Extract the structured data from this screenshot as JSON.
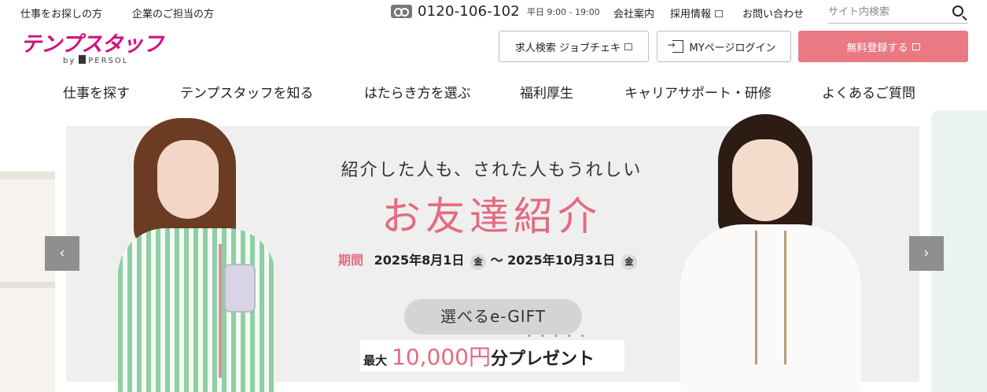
{
  "topbar": {
    "links": [
      "仕事をお探しの方",
      "企業のご担当の方"
    ],
    "phone": "0120-106-102",
    "hours": "平日 9:00 - 19:00",
    "right_links": [
      "会社案内",
      "採用情報",
      "お問い合わせ"
    ],
    "search_placeholder": "サイト内検索"
  },
  "logo": {
    "text": "テンプスタッフ",
    "by": "by",
    "brand": "PERSOL"
  },
  "header_buttons": {
    "job_search": "求人検索 ジョブチェキ",
    "login": "MYページログイン",
    "register": "無料登録する"
  },
  "nav": [
    "仕事を探す",
    "テンプスタッフを知る",
    "はたらき方を選ぶ",
    "福利厚生",
    "キャリアサポート・研修",
    "よくあるご質問"
  ],
  "banner": {
    "lead": "紹介した人も、された人もうれしい",
    "headline": "お友達紹介",
    "period_label": "期間",
    "start_date": "2025年8月1日",
    "start_dow": "金",
    "tilde": "～",
    "end_date": "2025年10月31日",
    "end_dow": "金",
    "pill": "選べるe-GIFT",
    "max": "最大",
    "amount": "10,000円",
    "present": "分プレゼント",
    "dots": "•••••"
  },
  "carousel": {
    "prev": "‹",
    "next": "›"
  },
  "colors": {
    "brand": "#d1127e",
    "register": "#e97a84",
    "accent": "#e36b81"
  }
}
